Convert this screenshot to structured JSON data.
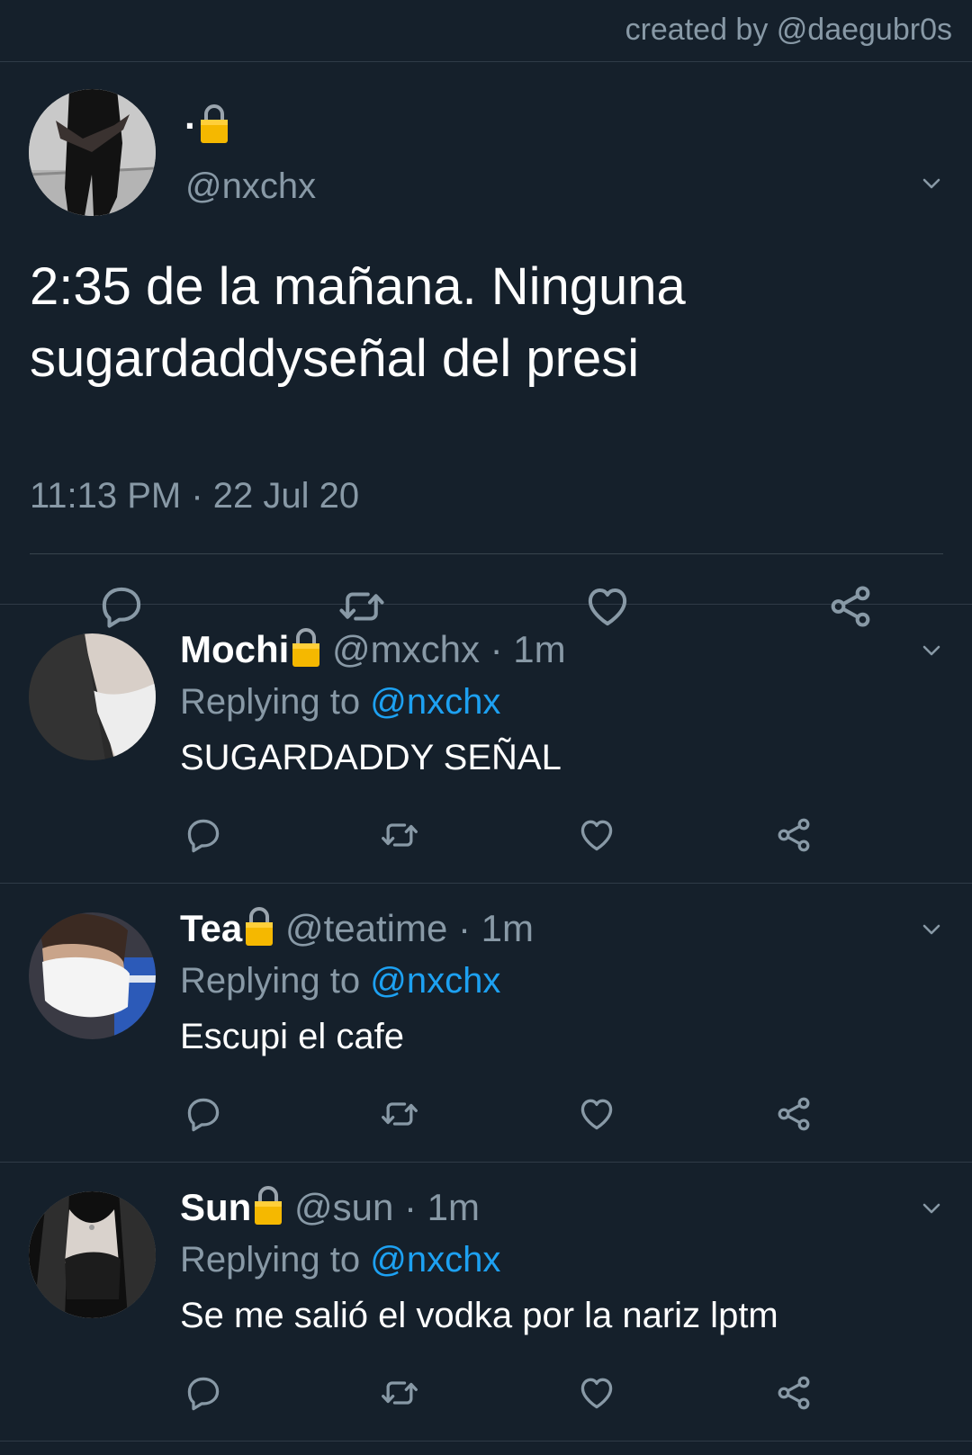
{
  "credit": "created by @daegubr0s",
  "main_tweet": {
    "display_name": "·",
    "handle": "@nxchx",
    "text": "2:35 de la mañana. Ninguna sugardaddyseñal del presi",
    "timestamp": "11:13 PM · 22 Jul 20"
  },
  "replies": [
    {
      "display_name": "Mochi",
      "handle_time": "@mxchx · 1m",
      "replying_prefix": "Replying to ",
      "replying_to": "@nxchx",
      "text": "SUGARDADDY SEÑAL"
    },
    {
      "display_name": "Tea",
      "handle_time": "@teatime · 1m",
      "replying_prefix": "Replying to ",
      "replying_to": "@nxchx",
      "text": "Escupi el cafe"
    },
    {
      "display_name": "Sun",
      "handle_time": "@sun · 1m",
      "replying_prefix": "Replying to ",
      "replying_to": "@nxchx",
      "text": "Se me salió el vodka por la nariz lptm"
    }
  ],
  "icons": {
    "lock": "lock-icon",
    "reply": "reply-icon",
    "retweet": "retweet-icon",
    "like": "heart-icon",
    "share": "share-icon",
    "more": "chevron-down-icon"
  },
  "colors": {
    "background": "#15202b",
    "text": "#ffffff",
    "muted": "#8899a6",
    "link": "#1da1f2",
    "lock": "#f5b800"
  }
}
